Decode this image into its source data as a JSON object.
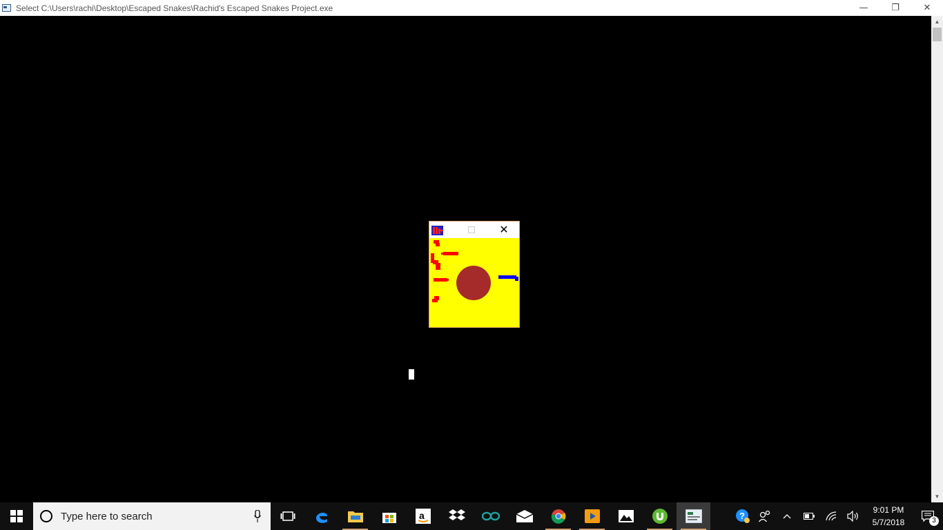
{
  "window": {
    "title": "Select C:\\Users\\rachi\\Desktop\\Escaped Snakes\\Rachid's Escaped Snakes Project.exe",
    "minimize_glyph": "—",
    "restore_glyph": "❐",
    "close_glyph": "✕"
  },
  "game_window": {
    "close_glyph": "✕",
    "colors": {
      "background": "#ffff00",
      "obstacle": "#a52a2a",
      "enemy_snake": "#ff0000",
      "player_snake": "#0000ff"
    }
  },
  "taskbar": {
    "search_placeholder": "Type here to search",
    "pinned": [
      "task-view-icon",
      "edge-icon",
      "file-explorer-icon",
      "store-icon",
      "amazon-icon",
      "dropbox-icon",
      "arduino-icon",
      "mail-icon",
      "chrome-icon",
      "media-player-icon",
      "photos-icon",
      "utorrent-icon",
      "console-app-icon"
    ],
    "tray": {
      "help_icon": "help-icon",
      "people_icon": "people-icon",
      "chevron_glyph": "^",
      "clock_time": "9:01 PM",
      "clock_date": "5/7/2018",
      "notification_count": "3"
    }
  }
}
